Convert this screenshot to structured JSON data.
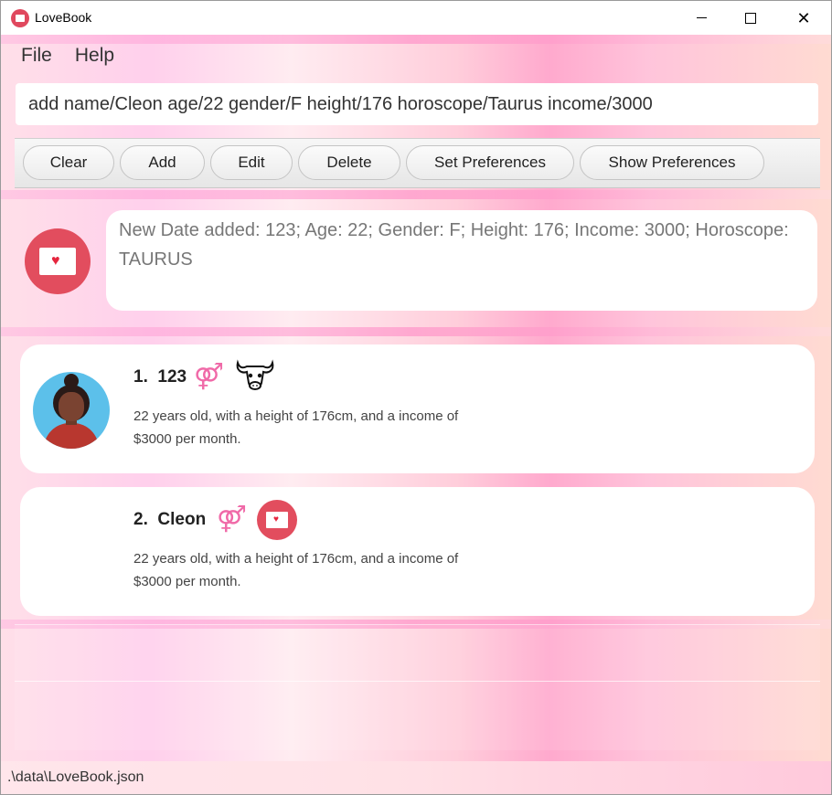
{
  "window": {
    "title": "LoveBook"
  },
  "menu": {
    "items": [
      "File",
      "Help"
    ]
  },
  "command_box": {
    "value": "add name/Cleon age/22 gender/F height/176 horoscope/Taurus income/3000"
  },
  "toolbar": {
    "buttons": [
      "Clear",
      "Add",
      "Edit",
      "Delete",
      "Set Preferences",
      "Show Preferences"
    ]
  },
  "result": {
    "message": "New Date added: 123; Age: 22; Gender: F; Height: 176; Income: 3000; Horoscope: TAURUS",
    "icon": "envelope-heart-icon"
  },
  "dates": [
    {
      "index": "1.",
      "name": "123",
      "description": "22 years old, with a height of 176cm, and a income of $3000 per month.",
      "gender_icon": "female-icon",
      "horoscope_icon": "taurus-bull-icon",
      "avatar": "avatar-woman"
    },
    {
      "index": "2.",
      "name": "Cleon",
      "description": "22 years old, with a height of 176cm, and a income of $3000 per month.",
      "gender_icon": "female-icon",
      "horoscope_icon": "envelope-heart-icon"
    }
  ],
  "status": {
    "path": ".\\data\\LoveBook.json"
  },
  "colors": {
    "accent": "#e24d5e",
    "pink": "#f06aa8"
  }
}
